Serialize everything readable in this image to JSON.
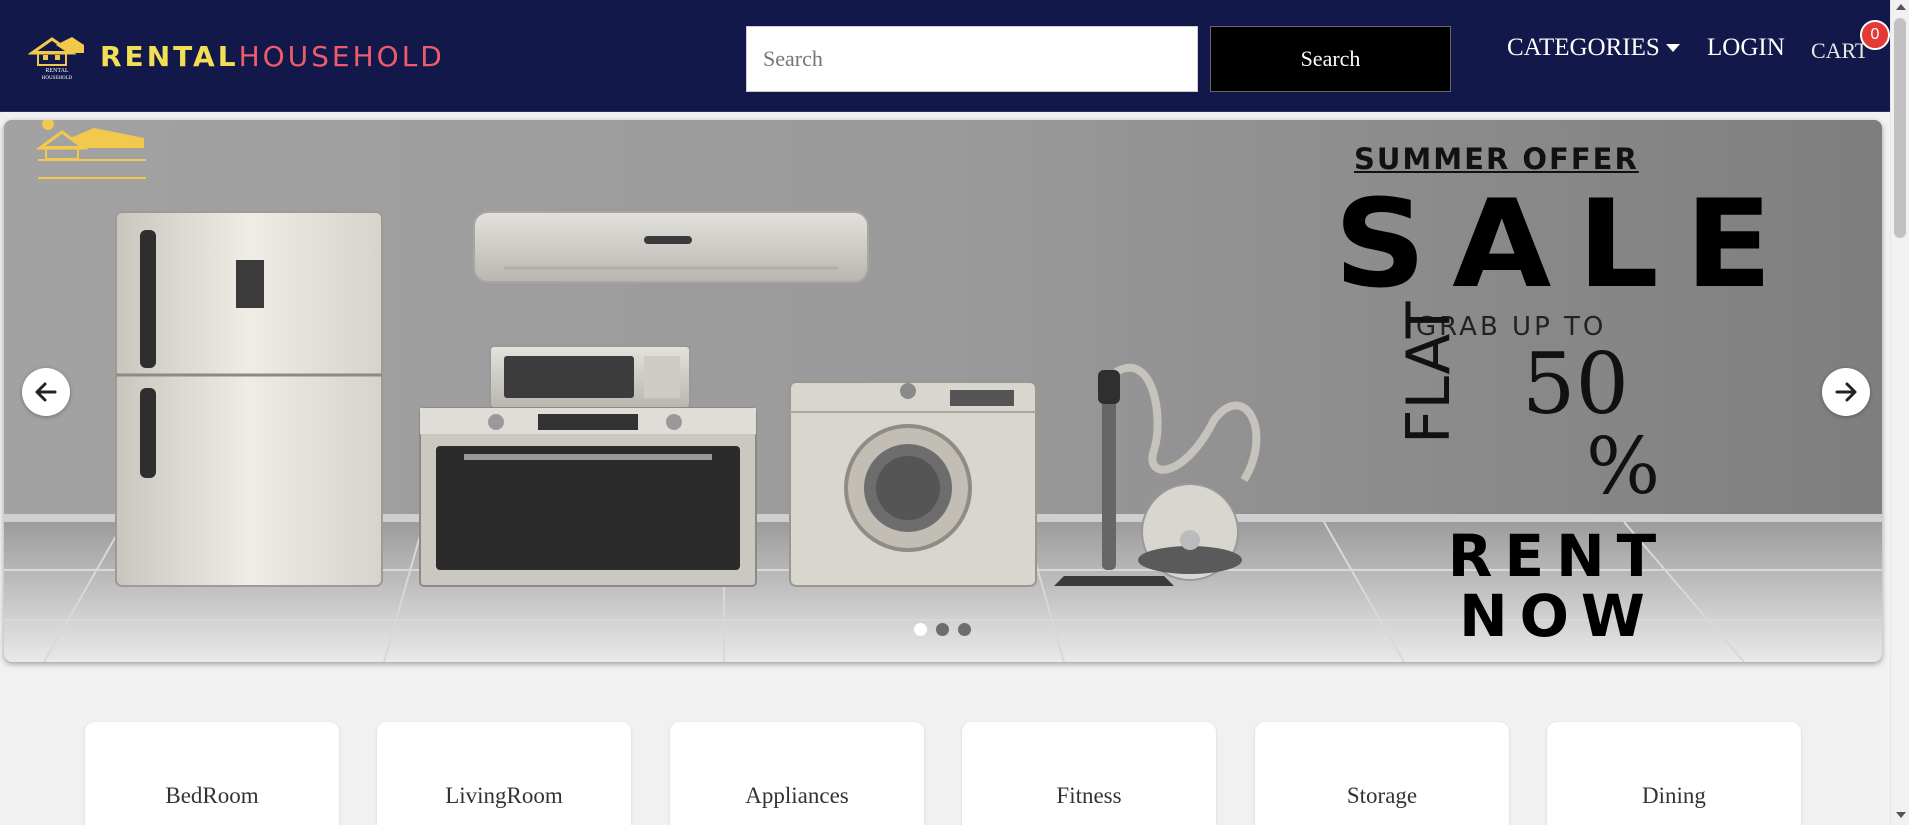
{
  "navbar": {
    "brand_part1": "RENTAL",
    "brand_part2": "HOUSEHOLD",
    "logo_icon": "house-logo-icon",
    "logo_text_line1": "RENTAL",
    "logo_text_line2": "HOUSEHOLD",
    "brand_colors": {
      "part1": "#f2df55",
      "part2": "#ee5b6c",
      "background": "#13184a"
    },
    "search": {
      "placeholder": "Search",
      "value": "",
      "button_label": "Search"
    },
    "categories_label": "CATEGORIES",
    "login_label": "LOGIN",
    "cart_label": "CART",
    "cart_count": "0"
  },
  "carousel": {
    "slide_count": 3,
    "active_index": 0,
    "prev_icon": "arrow-left-icon",
    "next_icon": "arrow-right-icon",
    "slide": {
      "offer_title": "SUMMER OFFER",
      "sale": "SALE",
      "grab": "GRAB UP TO",
      "flat": "FLAT",
      "discount": "50",
      "percent": "%",
      "cta_line1": "RENT",
      "cta_line2": "NOW"
    }
  },
  "categories": [
    {
      "label": "BedRoom"
    },
    {
      "label": "LivingRoom"
    },
    {
      "label": "Appliances"
    },
    {
      "label": "Fitness"
    },
    {
      "label": "Storage"
    },
    {
      "label": "Dining"
    }
  ]
}
